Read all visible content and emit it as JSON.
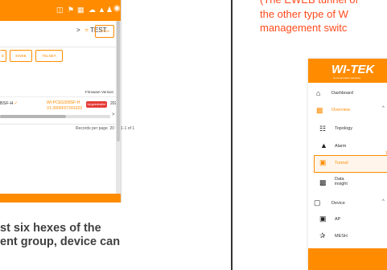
{
  "toolbar": {
    "icons": [
      "window-icon",
      "badge-icon",
      "grid-icon",
      "cloud-icon",
      "bell-icon",
      "users-icon",
      "account-icon"
    ]
  },
  "breadcrumb": {
    "arrow": ">",
    "wifi": "≈",
    "label": "TEST",
    "button": "ORGA"
  },
  "action_buttons": [
    "E",
    "EWEB",
    "TELNET"
  ],
  "table": {
    "header": "Firmware Version",
    "row": {
      "model": "BSF-H",
      "firmware_line1": "WI-PCES308SF-H",
      "firmware_line2": "V1.0005F07241023",
      "badge": "Upgradeable",
      "extra": "202"
    },
    "scroll_right": ">"
  },
  "pagination": {
    "label": "Records per page",
    "value": "20",
    "caret": "▾",
    "range": "1-1 of 1"
  },
  "caption": {
    "line1": "st six hexes of the",
    "line2": "ent group, device can"
  },
  "note": {
    "line1": "(The EWEB tunnel of",
    "line2": "the other type of W",
    "line3": "management switc"
  },
  "logo": {
    "text": "WI-TEK",
    "sub": "Communication Networks"
  },
  "nav": {
    "dashboard": "Dashboard",
    "overview": "Overview",
    "topology": "Topology",
    "alarm": "Alarm",
    "alarm_count": "1",
    "tunnel": "Tunnel",
    "data_insight_1": "Data",
    "data_insight_2": "insight",
    "device": "Device",
    "ap": "AP",
    "mesh": "MESH",
    "chevron": "^"
  },
  "colors": {
    "accent": "#ff8c00",
    "note_red": "#ff4a1c",
    "badge_red": "#e53935"
  }
}
